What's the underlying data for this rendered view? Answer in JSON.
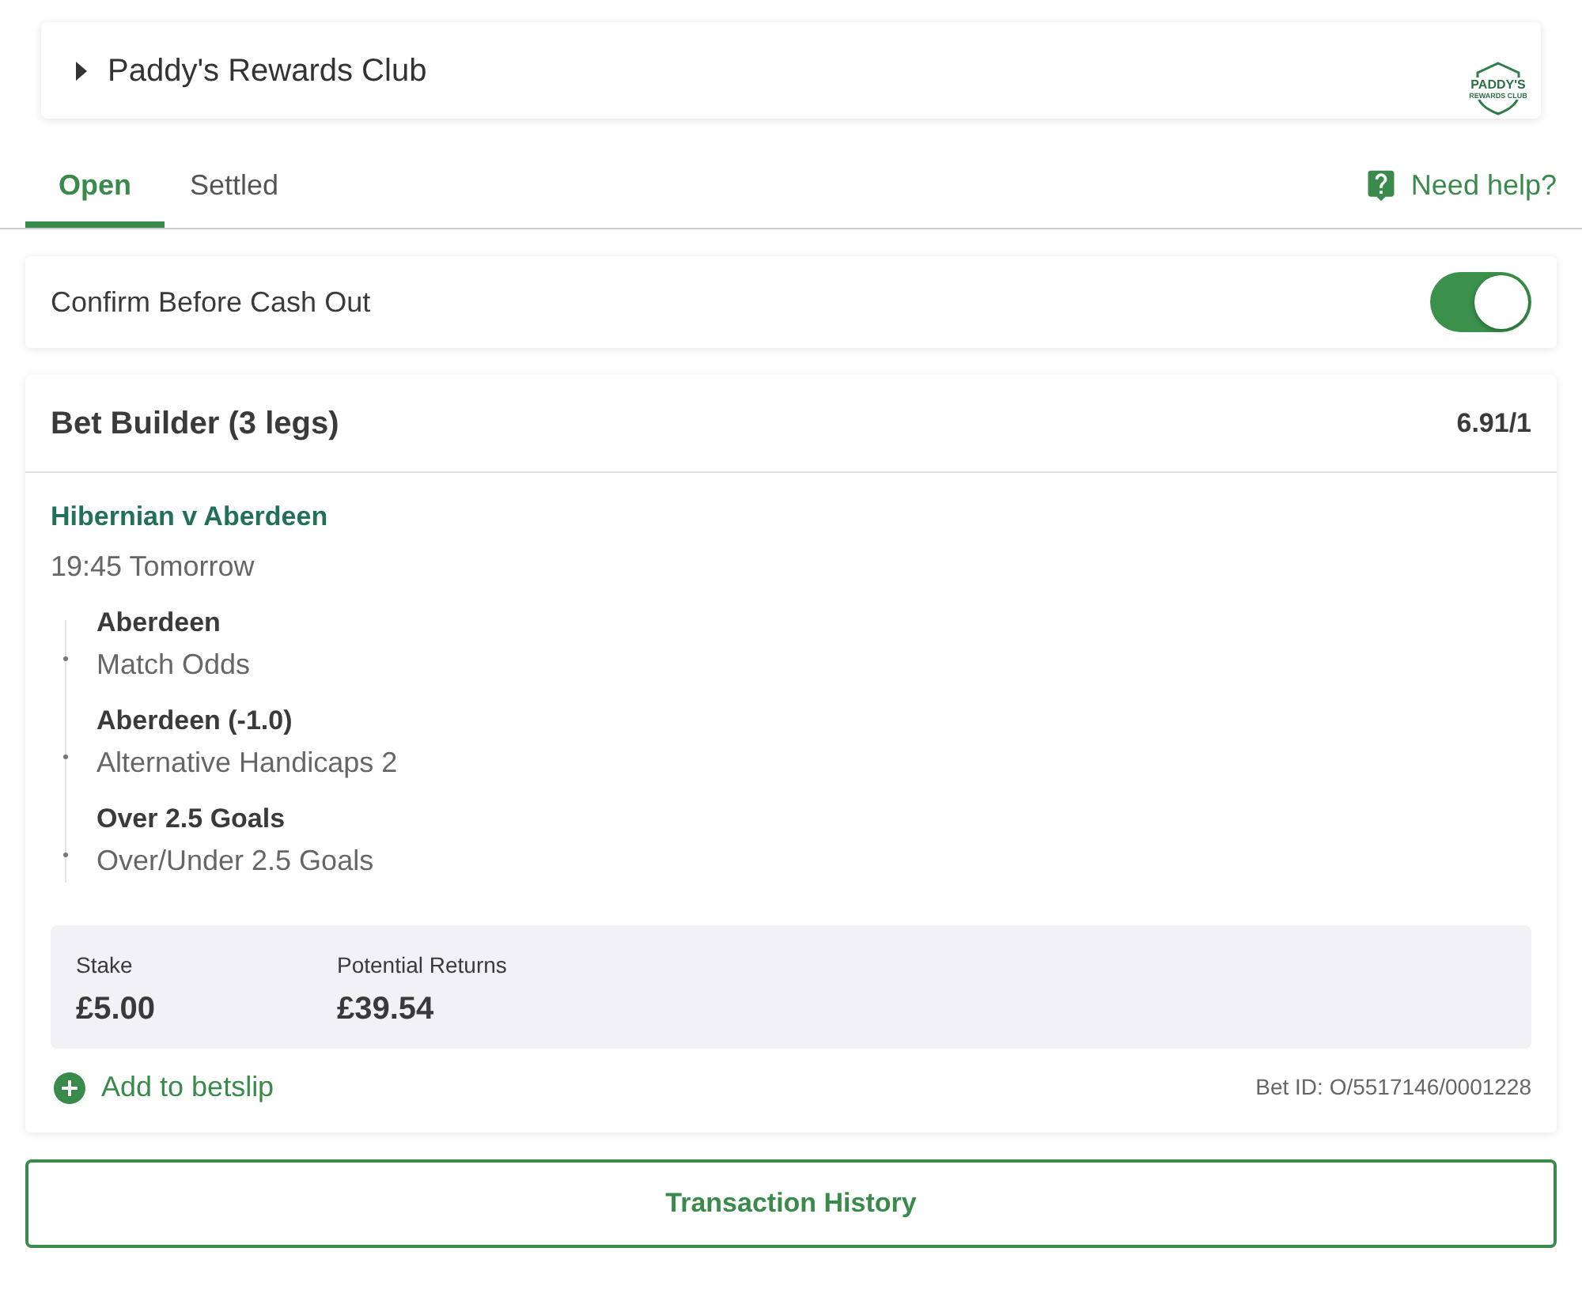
{
  "rewards_club": {
    "title": "Paddy's Rewards Club",
    "expanded": false,
    "logo": {
      "top": "PADDY'S",
      "bottom": "REWARDS CLUB"
    }
  },
  "tabs": [
    {
      "label": "Open",
      "selected": true
    },
    {
      "label": "Settled",
      "selected": false
    }
  ],
  "help_link": {
    "label": "Need help?"
  },
  "cash_out_setting": {
    "label": "Confirm Before Cash Out",
    "on": true
  },
  "bet": {
    "title": "Bet Builder (3 legs)",
    "odds": "6.91/1",
    "event": "Hibernian v Aberdeen",
    "start_time": "19:45 Tomorrow",
    "legs": [
      {
        "selection": "Aberdeen",
        "market": "Match Odds"
      },
      {
        "selection": "Aberdeen (-1.0)",
        "market": "Alternative Handicaps 2"
      },
      {
        "selection": "Over 2.5 Goals",
        "market": "Over/Under 2.5 Goals"
      }
    ],
    "stake_label": "Stake",
    "stake": "£5.00",
    "returns_label": "Potential Returns",
    "returns": "£39.54",
    "add_to_betslip": "Add to betslip",
    "bet_id": "Bet ID: O/5517146/0001228"
  },
  "transaction_history_button": {
    "label": "Transaction History"
  }
}
